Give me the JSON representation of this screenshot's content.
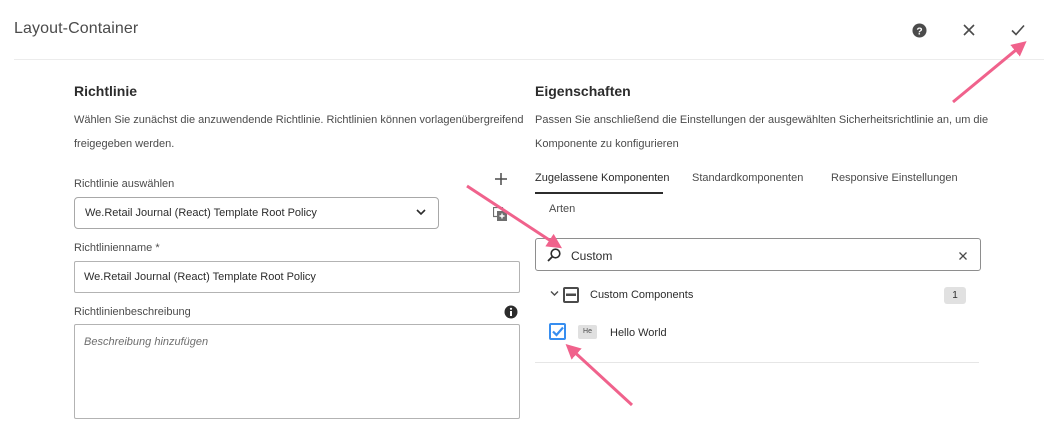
{
  "window": {
    "title": "Layout-Container"
  },
  "header": {
    "help_icon": "help-icon",
    "close_icon": "close-icon",
    "confirm_icon": "checkmark-icon"
  },
  "left": {
    "title": "Richtlinie",
    "description_line1": "Wählen Sie zunächst die anzuwendende Richtlinie. Richtlinien können vorlagenübergreifend",
    "description_line2": "freigegeben werden.",
    "select_label": "Richtlinie auswählen",
    "select_value": "We.Retail Journal (React) Template Root Policy",
    "name_label": "Richtlinienname *",
    "name_value": "We.Retail Journal (React) Template Root Policy",
    "desc_label": "Richtlinienbeschreibung",
    "desc_placeholder": "Beschreibung hinzufügen"
  },
  "right": {
    "title": "Eigenschaften",
    "description_line1": "Passen Sie anschließend die Einstellungen der ausgewählten Sicherheitsrichtlinie an, um die",
    "description_line2": "Komponente zu konfigurieren",
    "tabs": [
      {
        "label": "Zugelassene Komponenten",
        "active": true
      },
      {
        "label": "Standardkomponenten",
        "active": false
      },
      {
        "label": "Responsive Einstellungen",
        "active": false
      },
      {
        "label": "Arten",
        "active": false
      }
    ],
    "search_value": "Custom",
    "group": {
      "label": "Custom Components",
      "count": "1"
    },
    "items": [
      {
        "chip": "He",
        "label": "Hello World",
        "checked": true
      }
    ]
  },
  "colors": {
    "accent": "#378ef0",
    "arrow": "#f0628c"
  }
}
